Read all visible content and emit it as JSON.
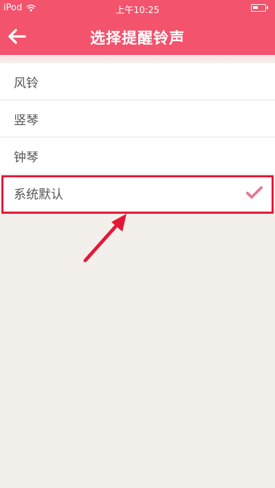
{
  "status_bar": {
    "carrier": "iPod",
    "time": "上午10:25"
  },
  "nav": {
    "title": "选择提醒铃声"
  },
  "ringtones": [
    {
      "label": "风铃",
      "selected": false
    },
    {
      "label": "竖琴",
      "selected": false
    },
    {
      "label": "钟琴",
      "selected": false
    },
    {
      "label": "系统默认",
      "selected": true
    }
  ],
  "colors": {
    "header": "#f3536d",
    "background": "#f3efea",
    "highlight": "#e31837",
    "check": "#e8788f"
  }
}
